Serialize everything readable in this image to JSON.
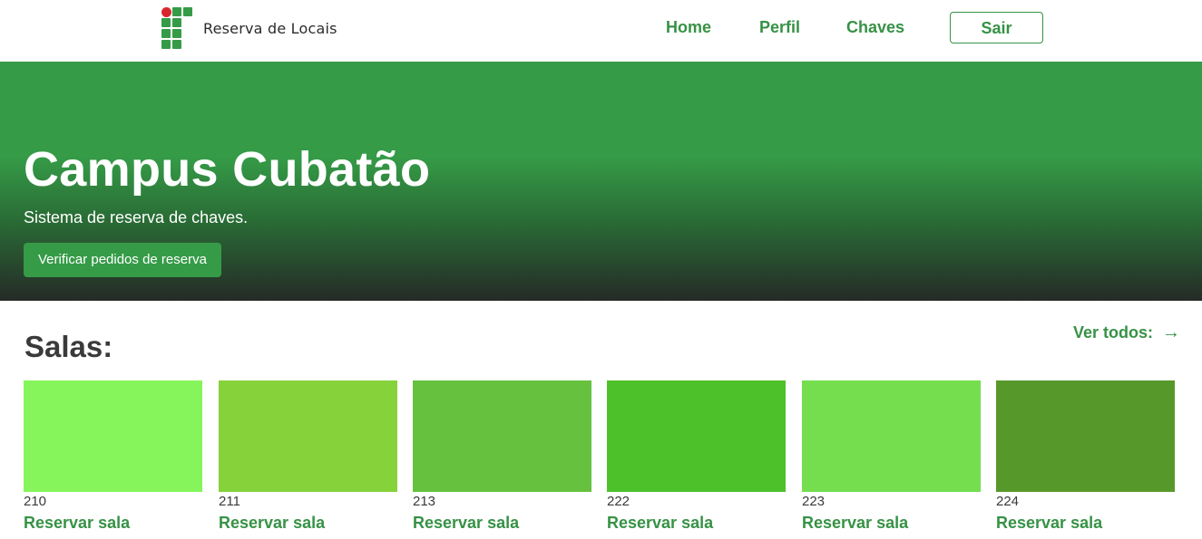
{
  "header": {
    "brand": "Reserva de Locais",
    "nav": [
      {
        "label": "Home"
      },
      {
        "label": "Perfil"
      },
      {
        "label": "Chaves"
      }
    ],
    "logout_label": "Sair"
  },
  "hero": {
    "title": "Campus Cubatão",
    "subtitle": "Sistema de reserva de chaves.",
    "button_label": "Verificar pedidos de reserva"
  },
  "rooms_section": {
    "title": "Salas:",
    "see_all_label": "Ver todos:",
    "see_all_icon": "arrow-right-icon",
    "rooms": [
      {
        "number": "210",
        "action": "Reservar sala",
        "color": "#86f55b"
      },
      {
        "number": "211",
        "action": "Reservar sala",
        "color": "#86d23a"
      },
      {
        "number": "213",
        "action": "Reservar sala",
        "color": "#66c23e"
      },
      {
        "number": "222",
        "action": "Reservar sala",
        "color": "#4dc12a"
      },
      {
        "number": "223",
        "action": "Reservar sala",
        "color": "#74de4f"
      },
      {
        "number": "224",
        "action": "Reservar sala",
        "color": "#57982b"
      }
    ]
  },
  "colors": {
    "primary_green": "#359b47",
    "hero_bottom": "#252b27",
    "logo_red": "#d8262e"
  }
}
